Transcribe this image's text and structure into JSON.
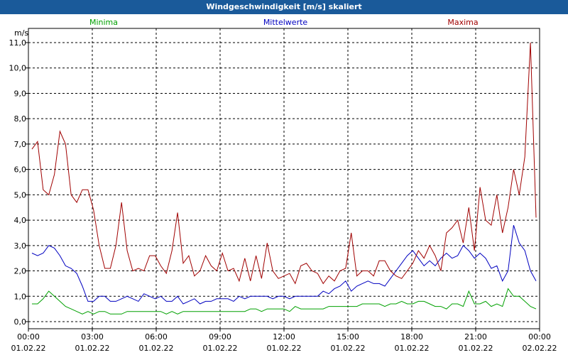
{
  "title": "Windgeschwindigkeit [m/s] skaliert",
  "colors": {
    "minima": "#00a000",
    "mittel": "#0000c0",
    "maxima": "#a00000"
  },
  "chart_data": {
    "type": "line",
    "ylabel": "m/s",
    "ylim": [
      0,
      11
    ],
    "grid": true,
    "legend": [
      "Minima",
      "Mittelwerte",
      "Maxima"
    ],
    "y_ticks": [
      "0,0",
      "1,0",
      "2,0",
      "3,0",
      "4,0",
      "5,0",
      "6,0",
      "7,0",
      "8,0",
      "9,0",
      "10,0",
      "11,0"
    ],
    "x_ticks": [
      {
        "time": "00:00",
        "date": "01.02.22"
      },
      {
        "time": "03:00",
        "date": "01.02.22"
      },
      {
        "time": "06:00",
        "date": "01.02.22"
      },
      {
        "time": "09:00",
        "date": "01.02.22"
      },
      {
        "time": "12:00",
        "date": "01.02.22"
      },
      {
        "time": "15:00",
        "date": "01.02.22"
      },
      {
        "time": "18:00",
        "date": "01.02.22"
      },
      {
        "time": "21:00",
        "date": "01.02.22"
      },
      {
        "time": "00:00",
        "date": "02.02.22"
      }
    ],
    "series": [
      {
        "name": "Minima",
        "values": [
          0.7,
          0.7,
          0.9,
          1.2,
          1.0,
          0.8,
          0.6,
          0.5,
          0.4,
          0.3,
          0.4,
          0.3,
          0.4,
          0.4,
          0.3,
          0.3,
          0.3,
          0.4,
          0.4,
          0.4,
          0.4,
          0.4,
          0.4,
          0.4,
          0.3,
          0.4,
          0.3,
          0.4,
          0.4,
          0.4,
          0.4,
          0.4,
          0.4,
          0.4,
          0.4,
          0.4,
          0.4,
          0.4,
          0.4,
          0.5,
          0.5,
          0.4,
          0.5,
          0.5,
          0.5,
          0.5,
          0.4,
          0.6,
          0.5,
          0.5,
          0.5,
          0.5,
          0.5,
          0.6,
          0.6,
          0.6,
          0.6,
          0.6,
          0.6,
          0.7,
          0.7,
          0.7,
          0.7,
          0.6,
          0.7,
          0.7,
          0.8,
          0.7,
          0.7,
          0.8,
          0.8,
          0.7,
          0.6,
          0.6,
          0.5,
          0.7,
          0.7,
          0.6,
          1.2,
          0.7,
          0.7,
          0.8,
          0.6,
          0.7,
          0.6,
          1.3,
          1.0,
          1.0,
          0.8,
          0.6,
          0.5
        ]
      },
      {
        "name": "Mittelwerte",
        "values": [
          2.7,
          2.6,
          2.7,
          3.0,
          2.9,
          2.6,
          2.2,
          2.1,
          1.9,
          1.4,
          0.8,
          0.8,
          1.0,
          1.0,
          0.8,
          0.8,
          0.9,
          1.0,
          0.9,
          0.8,
          1.1,
          1.0,
          0.9,
          1.0,
          0.8,
          0.8,
          1.0,
          0.7,
          0.8,
          0.9,
          0.7,
          0.8,
          0.8,
          0.9,
          0.9,
          0.9,
          0.8,
          1.0,
          0.9,
          1.0,
          1.0,
          1.0,
          1.0,
          0.9,
          1.0,
          1.0,
          0.9,
          1.0,
          1.0,
          1.0,
          1.0,
          1.0,
          1.2,
          1.1,
          1.3,
          1.4,
          1.6,
          1.2,
          1.4,
          1.5,
          1.6,
          1.5,
          1.5,
          1.4,
          1.7,
          2.0,
          2.3,
          2.6,
          2.8,
          2.5,
          2.2,
          2.4,
          2.2,
          2.5,
          2.7,
          2.5,
          2.6,
          3.0,
          2.8,
          2.5,
          2.7,
          2.5,
          2.1,
          2.2,
          1.6,
          2.0,
          3.8,
          3.1,
          2.8,
          2.0,
          1.6
        ]
      },
      {
        "name": "Maxima",
        "values": [
          6.8,
          7.1,
          5.2,
          5.0,
          5.8,
          7.5,
          7.0,
          5.0,
          4.7,
          5.2,
          5.2,
          4.4,
          3.0,
          2.1,
          2.1,
          3.0,
          4.7,
          2.8,
          2.0,
          2.1,
          2.0,
          2.6,
          2.6,
          2.2,
          1.9,
          2.8,
          4.3,
          2.3,
          2.6,
          1.8,
          2.0,
          2.6,
          2.2,
          2.0,
          2.7,
          2.0,
          2.1,
          1.6,
          2.5,
          1.6,
          2.6,
          1.7,
          3.1,
          2.0,
          1.7,
          1.8,
          1.9,
          1.5,
          2.2,
          2.3,
          2.0,
          1.9,
          1.5,
          1.8,
          1.6,
          2.0,
          2.1,
          3.5,
          1.8,
          2.0,
          2.0,
          1.8,
          2.4,
          2.4,
          2.0,
          1.8,
          1.7,
          2.0,
          2.3,
          2.8,
          2.5,
          3.0,
          2.6,
          2.0,
          3.5,
          3.7,
          4.0,
          3.1,
          4.5,
          2.8,
          5.3,
          4.0,
          3.8,
          5.0,
          3.5,
          4.5,
          6.0,
          5.0,
          6.5,
          11.0,
          4.1
        ]
      }
    ]
  }
}
